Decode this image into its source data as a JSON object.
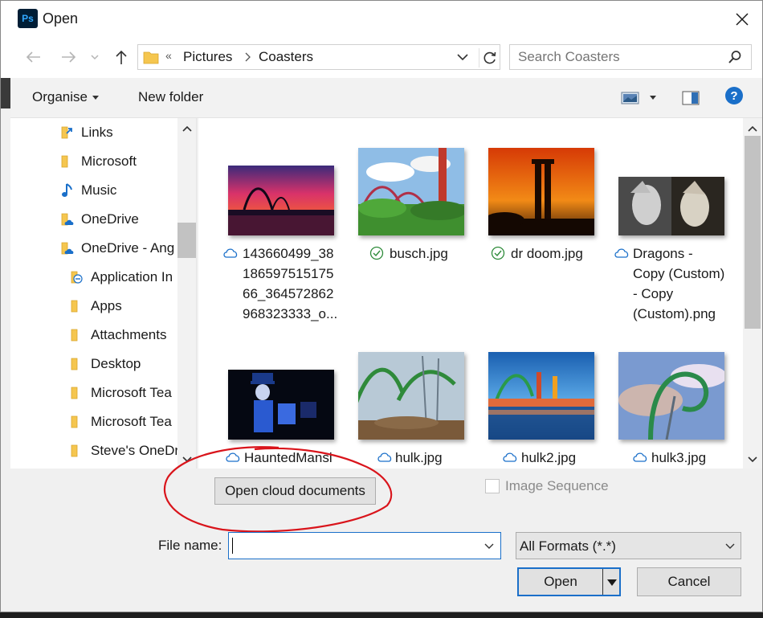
{
  "window": {
    "title": "Open",
    "app_icon_text": "Ps"
  },
  "address": {
    "overflow": "«",
    "crumbs": [
      "Pictures",
      "Coasters"
    ]
  },
  "search": {
    "placeholder": "Search Coasters"
  },
  "toolbar": {
    "organise_label": "Organise",
    "new_folder_label": "New folder",
    "help_label": "?"
  },
  "nav_pane": {
    "items": [
      {
        "label": "Links",
        "icon": "links-folder-icon"
      },
      {
        "label": "Microsoft",
        "icon": "folder-icon"
      },
      {
        "label": "Music",
        "icon": "music-note-icon"
      },
      {
        "label": "OneDrive",
        "icon": "onedrive-folder-icon"
      },
      {
        "label": "OneDrive - Ang",
        "icon": "onedrive-folder-icon"
      },
      {
        "label": "Application In",
        "icon": "shared-link-icon"
      },
      {
        "label": "Apps",
        "icon": "folder-icon"
      },
      {
        "label": "Attachments",
        "icon": "folder-icon"
      },
      {
        "label": "Desktop",
        "icon": "folder-icon"
      },
      {
        "label": "Microsoft Tea",
        "icon": "folder-icon"
      },
      {
        "label": "Microsoft Tea",
        "icon": "folder-icon"
      },
      {
        "label": "Steve's OneDr",
        "icon": "folder-icon"
      }
    ]
  },
  "files": [
    {
      "name": "143660499_38\n186597515175\n66_364572862\n968323333_o...",
      "status": "cloud"
    },
    {
      "name": "busch.jpg",
      "status": "synced"
    },
    {
      "name": "dr doom.jpg",
      "status": "synced"
    },
    {
      "name": "Dragons -\nCopy (Custom)\n- Copy\n(Custom).png",
      "status": "cloud"
    },
    {
      "name": "HauntedMansi",
      "status": "cloud"
    },
    {
      "name": "hulk.jpg",
      "status": "cloud"
    },
    {
      "name": "hulk2.jpg",
      "status": "cloud"
    },
    {
      "name": "hulk3.jpg",
      "status": "cloud"
    }
  ],
  "bottom": {
    "open_cloud_label": "Open cloud documents",
    "image_sequence_label": "Image Sequence",
    "image_sequence_checked": false,
    "file_name_label": "File name:",
    "file_name_value": "",
    "filter_value": "All Formats (*.*)",
    "open_label": "Open",
    "cancel_label": "Cancel"
  },
  "colors": {
    "accent": "#1a6fc9",
    "annotation_circle": "#d9141b",
    "cloud_status": "#1a6fc9",
    "synced_status": "#2e8b3a"
  }
}
